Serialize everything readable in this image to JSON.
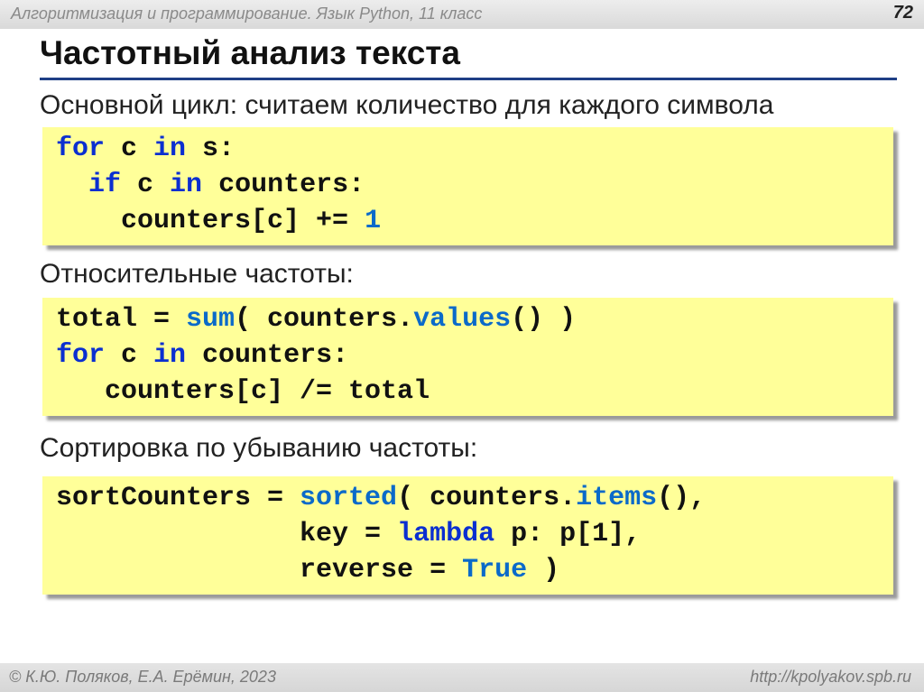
{
  "header": {
    "course": "Алгоритмизация и программирование. Язык Python, 11 класс",
    "slide_number": "72"
  },
  "title": "Частотный анализ текста",
  "sections": [
    {
      "heading": "Основной цикл: считаем количество для каждого символа",
      "code": {
        "line1": {
          "kw1": "for",
          "t1": " c ",
          "kw2": "in",
          "t2": " s:"
        },
        "line2": {
          "indent": "  ",
          "kw1": "if",
          "t1": " c ",
          "kw2": "in",
          "t2": " counters:"
        },
        "line3": {
          "t1": "    counters[c] += ",
          "num": "1"
        }
      }
    },
    {
      "heading": "Относительные частоты:",
      "code": {
        "line1": {
          "t1": "total = ",
          "fn1": "sum",
          "t2": "( counters.",
          "fn2": "values",
          "t3": "() )"
        },
        "line2": {
          "kw1": "for",
          "t1": " c ",
          "kw2": "in",
          "t2": " counters:"
        },
        "line3": {
          "t1": "   counters[c] /= total"
        }
      }
    },
    {
      "heading": "Сортировка по убыванию частоты:",
      "code": {
        "line1": {
          "t1": "sortCounters = ",
          "fn1": "sorted",
          "t2": "( counters.",
          "fn2": "items",
          "t3": "(),"
        },
        "line2": {
          "t1": "               key = ",
          "kw1": "lambda",
          "t2": " p: p[1],"
        },
        "line3": {
          "t1": "               reverse = ",
          "kw1": "True",
          "t2": " )"
        }
      }
    }
  ],
  "footer": {
    "authors": "© К.Ю. Поляков, Е.А. Ерёмин, 2023",
    "url": "http://kpolyakov.spb.ru"
  },
  "colors": {
    "keyword": "#0b2fd0",
    "builtin": "#0b6ac9",
    "code_background": "#ffff99",
    "title_rule": "#1f3f86"
  }
}
